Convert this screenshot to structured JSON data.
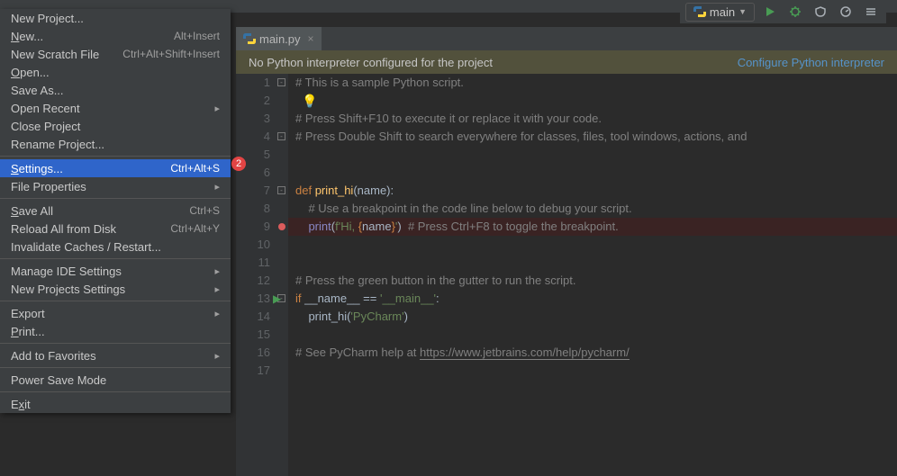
{
  "toolbar": {
    "configName": "main",
    "icons": [
      "play-icon",
      "debug-icon",
      "run-cov-icon",
      "profile-icon",
      "search-everywhere-icon"
    ]
  },
  "tab": {
    "label": "main.py"
  },
  "banner": {
    "msg": "No Python interpreter configured for the project",
    "action": "Configure Python interpreter"
  },
  "badge": "2",
  "menu": [
    {
      "t": "item",
      "label": "New Project...",
      "kb": ""
    },
    {
      "t": "item",
      "label": "New...",
      "u": 0,
      "kb": "Alt+Insert"
    },
    {
      "t": "item",
      "label": "New Scratch File",
      "kb": "Ctrl+Alt+Shift+Insert"
    },
    {
      "t": "item",
      "label": "Open...",
      "u": 0,
      "kb": ""
    },
    {
      "t": "item",
      "label": "Save As...",
      "kb": ""
    },
    {
      "t": "item",
      "label": "Open Recent",
      "kb": "",
      "sub": true
    },
    {
      "t": "item",
      "label": "Close Project",
      "kb": ""
    },
    {
      "t": "item",
      "label": "Rename Project...",
      "kb": ""
    },
    {
      "t": "sep"
    },
    {
      "t": "item",
      "label": "Settings...",
      "u": 0,
      "kb": "Ctrl+Alt+S",
      "sel": true
    },
    {
      "t": "item",
      "label": "File Properties",
      "kb": "",
      "sub": true
    },
    {
      "t": "sep"
    },
    {
      "t": "item",
      "label": "Save All",
      "u": 0,
      "kb": "Ctrl+S"
    },
    {
      "t": "item",
      "label": "Reload All from Disk",
      "kb": "Ctrl+Alt+Y"
    },
    {
      "t": "item",
      "label": "Invalidate Caches / Restart...",
      "kb": ""
    },
    {
      "t": "sep"
    },
    {
      "t": "item",
      "label": "Manage IDE Settings",
      "kb": "",
      "sub": true
    },
    {
      "t": "item",
      "label": "New Projects Settings",
      "kb": "",
      "sub": true
    },
    {
      "t": "sep"
    },
    {
      "t": "item",
      "label": "Export",
      "kb": "",
      "sub": true
    },
    {
      "t": "item",
      "label": "Print...",
      "u": 0,
      "kb": ""
    },
    {
      "t": "sep"
    },
    {
      "t": "item",
      "label": "Add to Favorites",
      "kb": "",
      "sub": true
    },
    {
      "t": "sep"
    },
    {
      "t": "item",
      "label": "Power Save Mode",
      "kb": ""
    },
    {
      "t": "sep"
    },
    {
      "t": "item",
      "label": "Exit",
      "u": 1,
      "kb": ""
    }
  ],
  "editor": {
    "lineStart": 1,
    "lineCount": 17,
    "breakpointLine": 9,
    "runMarkerLine": 13,
    "lines": [
      {
        "html": "<span class='fold'>-</span><span class='c'># This is a sample Python script.</span>"
      },
      {
        "html": "  <span class='bulb'>💡</span>"
      },
      {
        "html": "<span class='c'># Press Shift+F10 to execute it or replace it with your code.</span>"
      },
      {
        "html": "<span class='fold'>-</span><span class='c'># Press Double Shift to search everywhere for classes, files, tool windows, actions, and </span>"
      },
      {
        "html": ""
      },
      {
        "html": ""
      },
      {
        "html": "<span class='fold'>-</span><span class='k'>def </span><span class='fn'>print_hi</span>(name):"
      },
      {
        "html": "    <span class='c'># Use a breakpoint in the code line below to debug your script.</span>"
      },
      {
        "bp": true,
        "html": "    <span class='bi'>print</span>(<span class='s'>f'Hi, </span><span class='br'>{</span>name<span class='br'>}</span><span class='s'>'</span>)  <span class='c'># Press Ctrl+F8 to toggle the breakpoint.</span>"
      },
      {
        "html": ""
      },
      {
        "html": ""
      },
      {
        "html": "<span class='c'># Press the green button in the gutter to run the script.</span>"
      },
      {
        "run": true,
        "html": "<span class='fold'>-</span><span class='k'>if</span> __name__ == <span class='s'>'__main__'</span>:"
      },
      {
        "html": "    print_hi(<span class='s'>'PyCharm'</span>)"
      },
      {
        "html": ""
      },
      {
        "html": "<span class='c'># See PyCharm help at </span><span class='lnk'>https://www.jetbrains.com/help/pycharm/</span>"
      },
      {
        "html": ""
      }
    ]
  }
}
